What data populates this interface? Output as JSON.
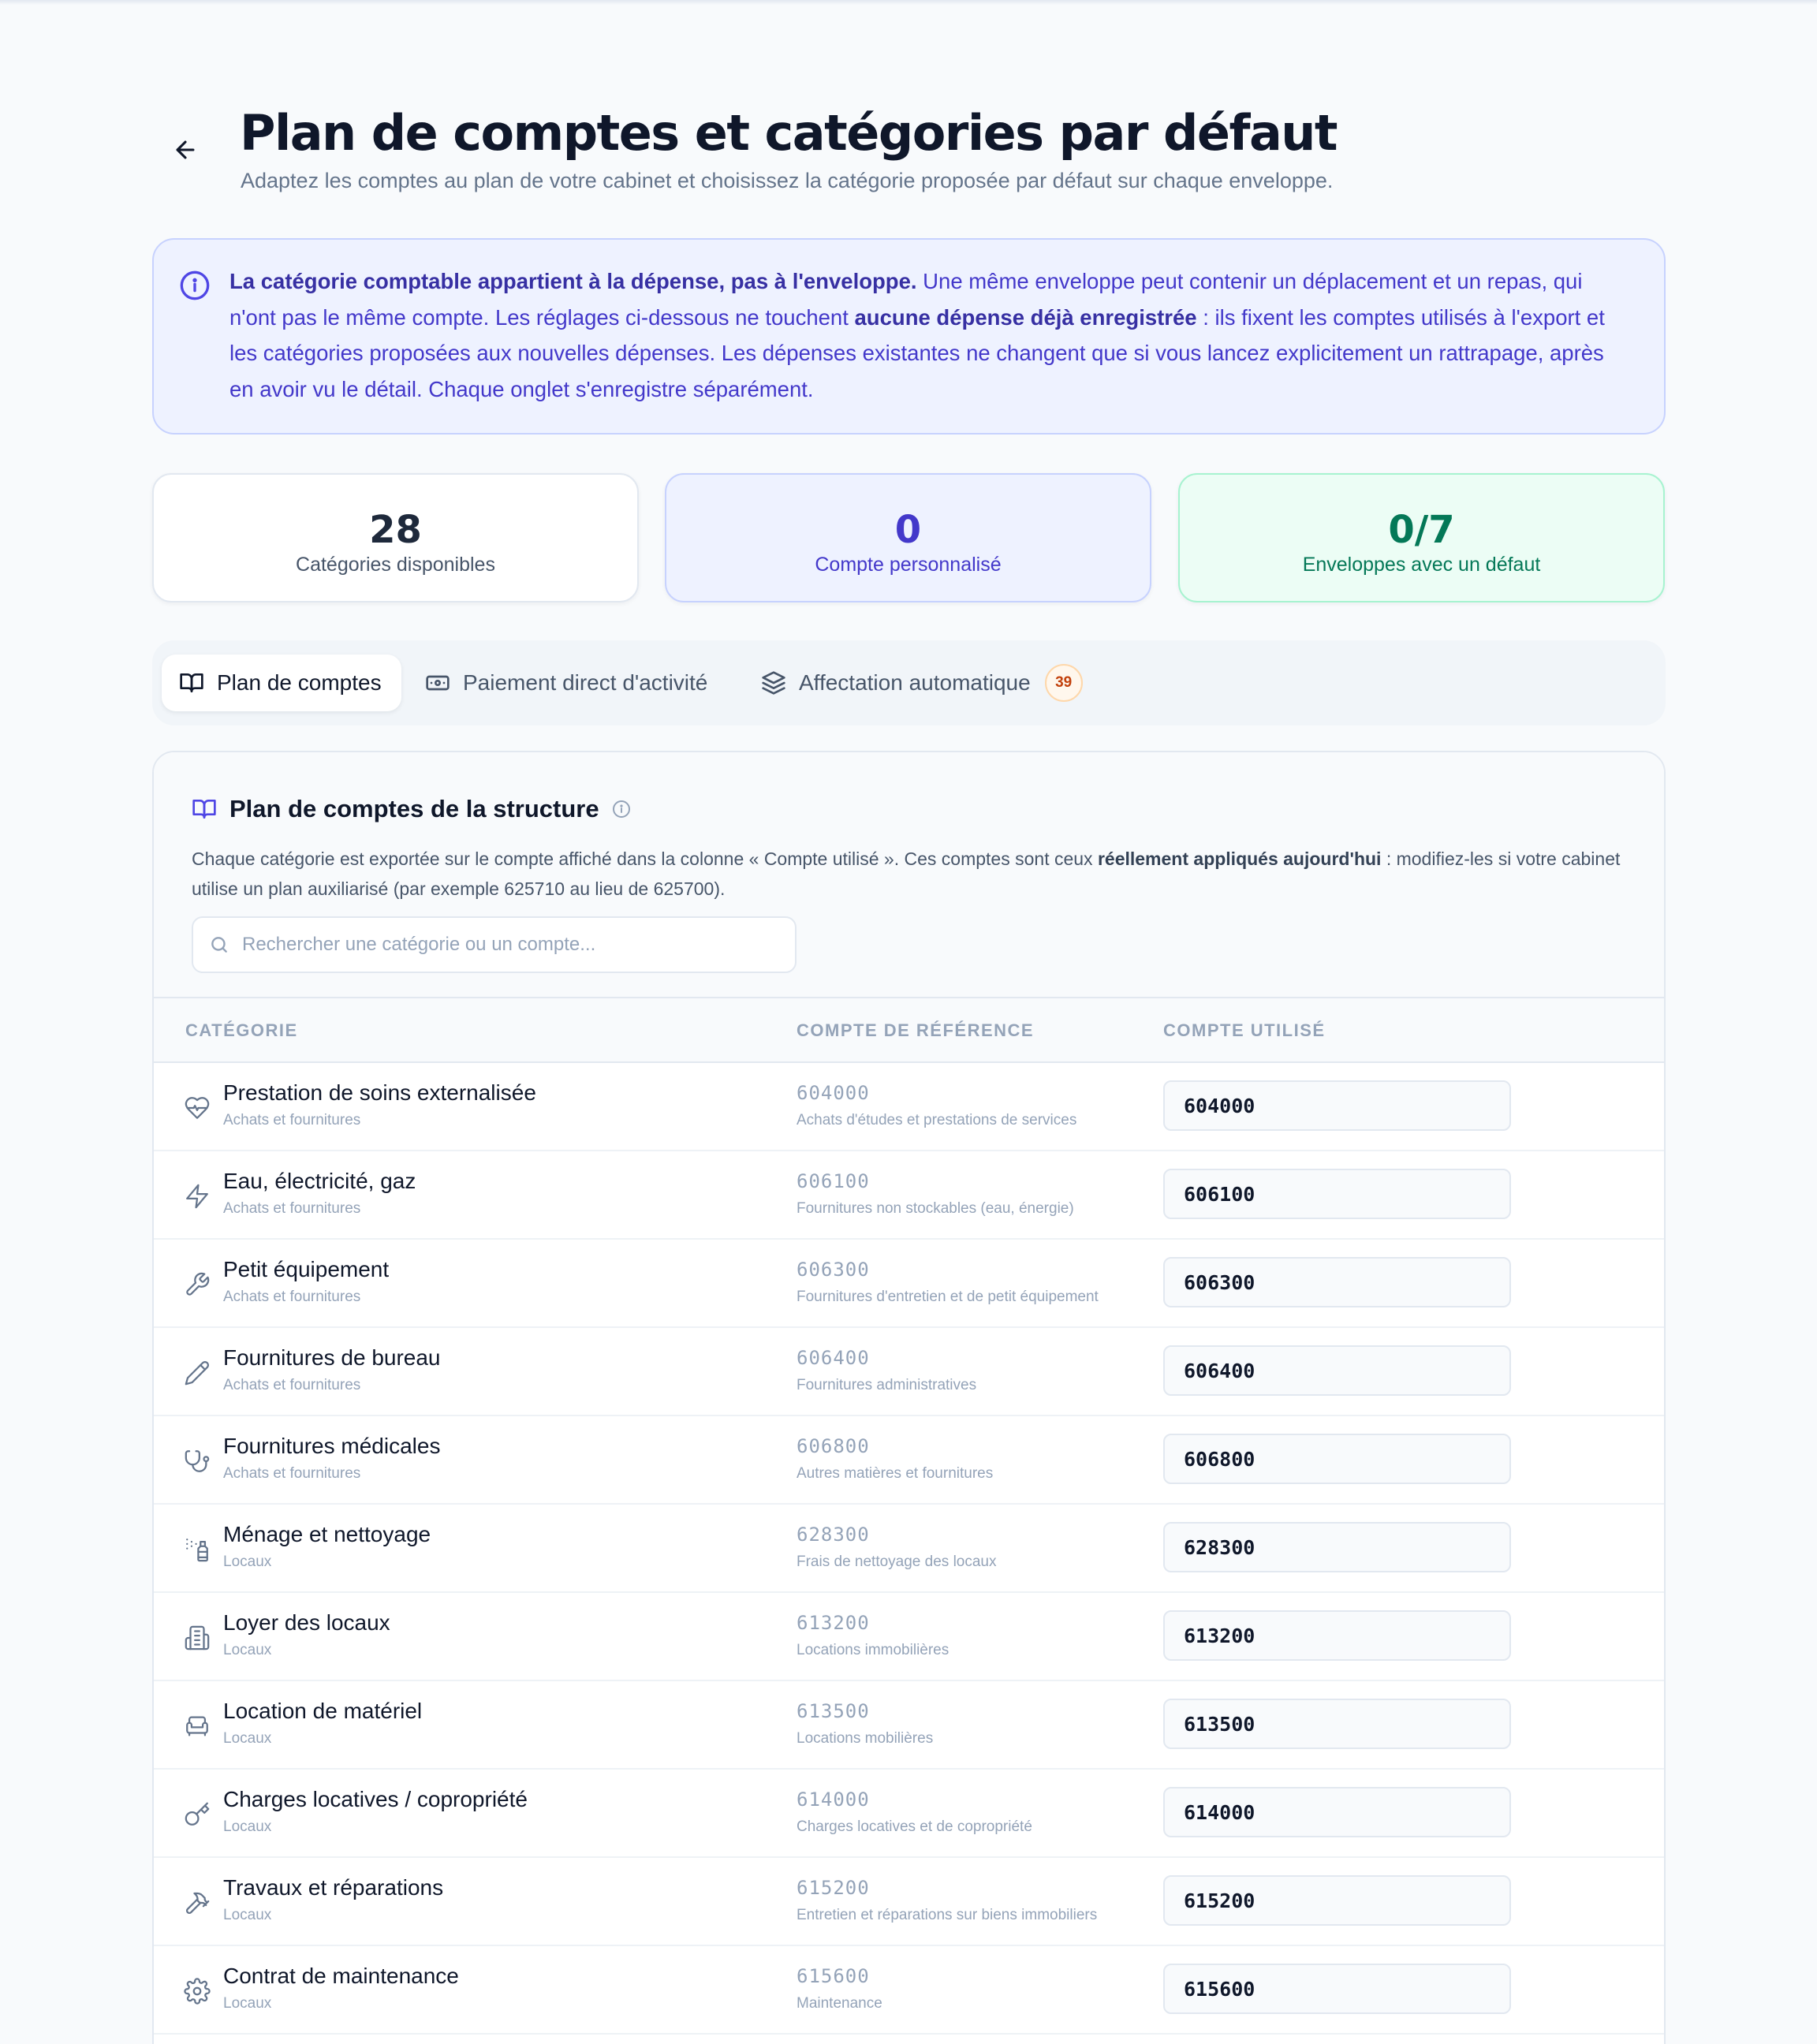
{
  "header": {
    "title": "Plan de comptes et catégories par défaut",
    "subtitle": "Adaptez les comptes au plan de votre cabinet et choisissez la catégorie proposée par défaut sur chaque enveloppe."
  },
  "info_banner": {
    "strong_1": "La catégorie comptable appartient à la dépense, pas à l'enveloppe.",
    "text_1": " Une même enveloppe peut contenir un déplacement et un repas, qui n'ont pas le même compte. Les réglages ci-dessous ne touchent ",
    "strong_2": "aucune dépense déjà enregistrée",
    "text_2": " : ils fixent les comptes utilisés à l'export et les catégories proposées aux nouvelles dépenses. Les dépenses existantes ne changent que si vous lancez explicitement un rattrapage, après en avoir vu le détail. Chaque onglet s'enregistre séparément."
  },
  "stats": [
    {
      "value": "28",
      "label": "Catégories disponibles"
    },
    {
      "value": "0",
      "label": "Compte personnalisé"
    },
    {
      "value": "0/7",
      "label": "Enveloppes avec un défaut"
    }
  ],
  "tabs": [
    {
      "label": "Plan de comptes",
      "icon": "book-open-icon",
      "active": true
    },
    {
      "label": "Paiement direct d'activité",
      "icon": "banknote-icon"
    },
    {
      "label": "Affectation automatique",
      "icon": "layers-icon",
      "badge": "39"
    }
  ],
  "panel": {
    "title": "Plan de comptes de la structure",
    "desc_1": "Chaque catégorie est exportée sur le compte affiché dans la colonne « Compte utilisé ». Ces comptes sont ceux ",
    "desc_strong": "réellement appliqués aujourd'hui",
    "desc_2": " : modifiez-les si votre cabinet utilise un plan auxiliarisé (par exemple 625710 au lieu de 625700).",
    "search_placeholder": "Rechercher une catégorie ou un compte...",
    "columns": [
      "CATÉGORIE",
      "COMPTE DE RÉFÉRENCE",
      "COMPTE UTILISÉ"
    ]
  },
  "rows": [
    {
      "icon": "heart-pulse-icon",
      "name": "Prestation de soins externalisée",
      "group": "Achats et fournitures",
      "ref_code": "604000",
      "ref_label": "Achats d'études et prestations de services",
      "used": "604000"
    },
    {
      "icon": "zap-icon",
      "name": "Eau, électricité, gaz",
      "group": "Achats et fournitures",
      "ref_code": "606100",
      "ref_label": "Fournitures non stockables (eau, énergie)",
      "used": "606100"
    },
    {
      "icon": "wrench-icon",
      "name": "Petit équipement",
      "group": "Achats et fournitures",
      "ref_code": "606300",
      "ref_label": "Fournitures d'entretien et de petit équipement",
      "used": "606300"
    },
    {
      "icon": "pencil-icon",
      "name": "Fournitures de bureau",
      "group": "Achats et fournitures",
      "ref_code": "606400",
      "ref_label": "Fournitures administratives",
      "used": "606400"
    },
    {
      "icon": "stethoscope-icon",
      "name": "Fournitures médicales",
      "group": "Achats et fournitures",
      "ref_code": "606800",
      "ref_label": "Autres matières et fournitures",
      "used": "606800"
    },
    {
      "icon": "spray-bottle-icon",
      "name": "Ménage et nettoyage",
      "group": "Locaux",
      "ref_code": "628300",
      "ref_label": "Frais de nettoyage des locaux",
      "used": "628300"
    },
    {
      "icon": "building-icon",
      "name": "Loyer des locaux",
      "group": "Locaux",
      "ref_code": "613200",
      "ref_label": "Locations immobilières",
      "used": "613200"
    },
    {
      "icon": "armchair-icon",
      "name": "Location de matériel",
      "group": "Locaux",
      "ref_code": "613500",
      "ref_label": "Locations mobilières",
      "used": "613500"
    },
    {
      "icon": "key-icon",
      "name": "Charges locatives / copropriété",
      "group": "Locaux",
      "ref_code": "614000",
      "ref_label": "Charges locatives et de copropriété",
      "used": "614000"
    },
    {
      "icon": "hammer-icon",
      "name": "Travaux et réparations",
      "group": "Locaux",
      "ref_code": "615200",
      "ref_label": "Entretien et réparations sur biens immobiliers",
      "used": "615200"
    },
    {
      "icon": "gear-icon",
      "name": "Contrat de maintenance",
      "group": "Locaux",
      "ref_code": "615600",
      "ref_label": "Maintenance",
      "used": "615600"
    },
    {
      "icon": "tag-icon",
      "name": "",
      "group": "",
      "ref_code": "",
      "ref_label": "",
      "used": ""
    }
  ],
  "colors": {
    "accent": "#4338ca",
    "success": "#047857",
    "badge": "#c2410c"
  }
}
